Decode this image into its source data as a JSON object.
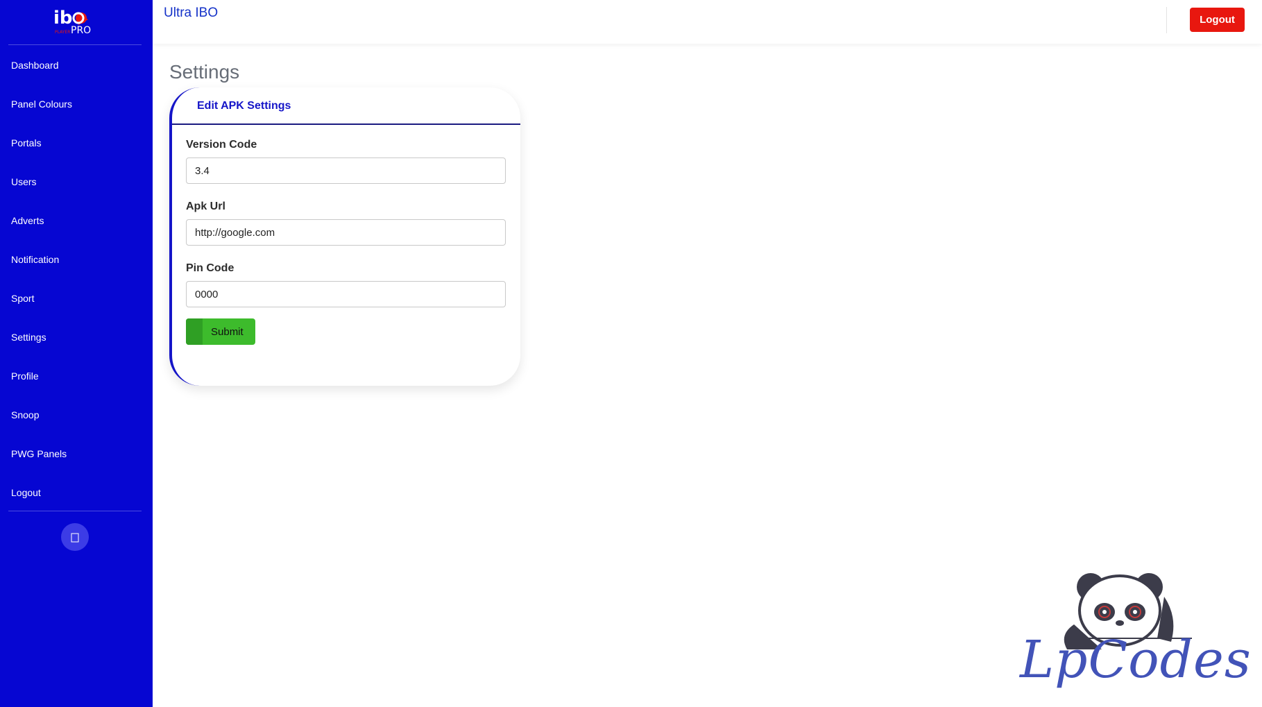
{
  "brand": {
    "logo_text": "ibo PRO",
    "logo_color_primary": "#ffffff",
    "logo_color_accent": "#e8170f"
  },
  "sidebar": {
    "items": [
      {
        "label": "Dashboard"
      },
      {
        "label": "Panel Colours"
      },
      {
        "label": "Portals"
      },
      {
        "label": "Users"
      },
      {
        "label": "Adverts"
      },
      {
        "label": "Notification"
      },
      {
        "label": "Sport"
      },
      {
        "label": "Settings"
      },
      {
        "label": "Profile"
      },
      {
        "label": "Snoop"
      },
      {
        "label": "PWG Panels"
      },
      {
        "label": "Logout"
      }
    ],
    "toggle_icon": "chevron-left-icon",
    "background_color": "#0606d2"
  },
  "topbar": {
    "title": "Ultra IBO",
    "logout_label": "Logout",
    "logout_color": "#e8170f"
  },
  "page": {
    "title": "Settings"
  },
  "card": {
    "header_title": "Edit APK Settings",
    "fields": [
      {
        "label": "Version Code",
        "value": "3.4"
      },
      {
        "label": "Apk Url",
        "value": "http://google.com"
      },
      {
        "label": "Pin Code",
        "value": "0000"
      }
    ],
    "submit_label": "Submit",
    "submit_color": "#3dbb2c"
  },
  "watermark": {
    "text": "LpCodes",
    "mascot_icon": "panda-mascot-icon"
  }
}
